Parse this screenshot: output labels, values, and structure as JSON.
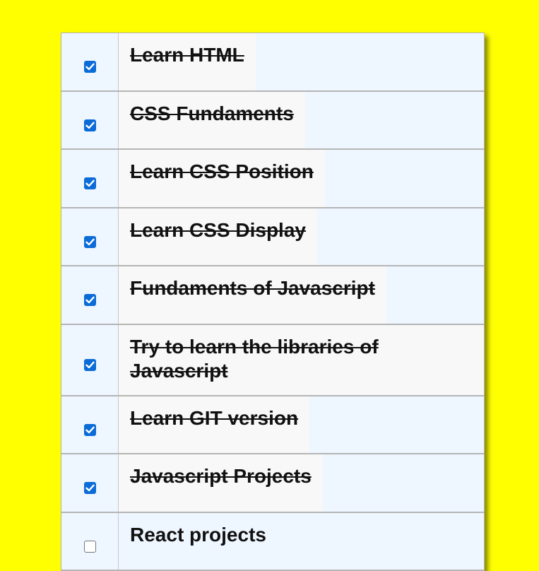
{
  "colors": {
    "page_background": "#ffff00",
    "list_background": "#eef6ff",
    "item_text_background": "#f8f8f8",
    "checkbox_checked": "#0b6cd8"
  },
  "todos": [
    {
      "text": "Learn HTML",
      "done": true
    },
    {
      "text": "CSS Fundaments",
      "done": true
    },
    {
      "text": "Learn CSS Position",
      "done": true
    },
    {
      "text": "Learn CSS Display",
      "done": true
    },
    {
      "text": "Fundaments of Javascript",
      "done": true
    },
    {
      "text": "Try to learn the libraries of Javascript",
      "done": true
    },
    {
      "text": "Learn GIT version",
      "done": true
    },
    {
      "text": "Javascript Projects",
      "done": true
    },
    {
      "text": "React projects",
      "done": false
    }
  ]
}
